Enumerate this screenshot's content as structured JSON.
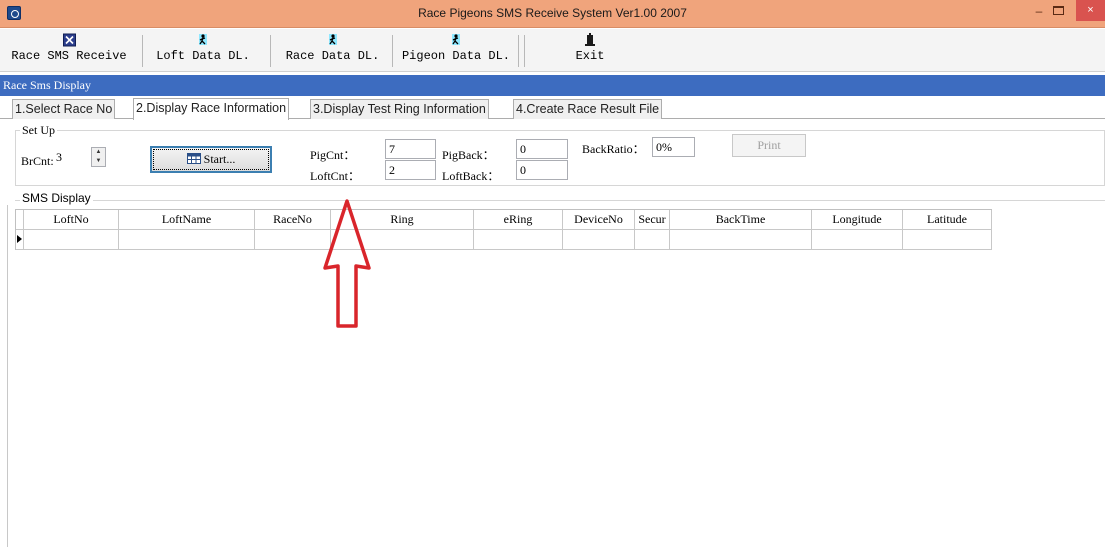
{
  "window": {
    "title": "Race Pigeons SMS Receive System Ver1.00 2007",
    "minimize_glyph": "–",
    "close_glyph": "×"
  },
  "toolbar": {
    "buttons": [
      {
        "label": "Race SMS Receive",
        "icon": "sms-receive-icon"
      },
      {
        "label": "Loft Data DL.",
        "icon": "runner-icon"
      },
      {
        "label": "Race Data DL.",
        "icon": "runner-icon"
      },
      {
        "label": "Pigeon Data DL.",
        "icon": "runner-icon"
      },
      {
        "label": "Exit",
        "icon": "exit-door-icon"
      }
    ]
  },
  "section": {
    "title": "Race Sms Display"
  },
  "tabs": [
    {
      "label": "1.Select Race No",
      "active": false
    },
    {
      "label": "2.Display Race Information",
      "active": true
    },
    {
      "label": "3.Display Test Ring Information",
      "active": false
    },
    {
      "label": "4.Create Race Result File",
      "active": false
    }
  ],
  "setup": {
    "legend": "Set Up",
    "brcnt_label": "BrCnt:",
    "brcnt_value": "3",
    "start_label": "Start...",
    "pigcnt_label": "PigCnt：",
    "pigcnt_value": "7",
    "loftcnt_label": "LoftCnt：",
    "loftcnt_value": "2",
    "pigback_label": "PigBack：",
    "pigback_value": "0",
    "loftback_label": "LoftBack：",
    "loftback_value": "0",
    "backratio_label": "BackRatio：",
    "backratio_value": "0%",
    "print_label": "Print"
  },
  "sms_display": {
    "legend": "SMS Display",
    "columns": [
      "LoftNo",
      "LoftName",
      "RaceNo",
      "Ring",
      "eRing",
      "DeviceNo",
      "Secur",
      "BackTime",
      "Longitude",
      "Latitude"
    ],
    "rows": [
      [
        "",
        "",
        "",
        "",
        "",
        "",
        "",
        "",
        "",
        ""
      ]
    ]
  },
  "annotation": {
    "color": "#d9252b",
    "shape": "up-arrow-outline"
  },
  "colors": {
    "titlebar": "#f0a47c",
    "section_bar": "#3d6cc0"
  }
}
